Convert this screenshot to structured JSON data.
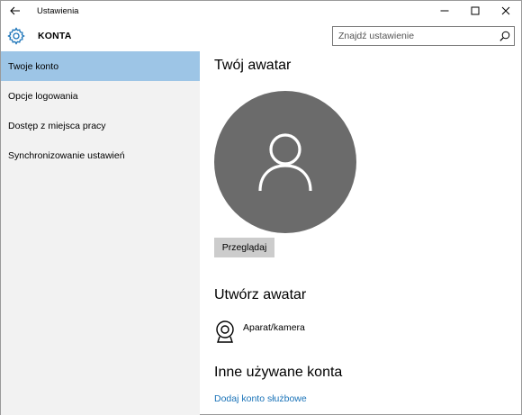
{
  "titlebar": {
    "title": "Ustawienia",
    "back_icon": "arrow-left-icon",
    "controls": [
      "minimize-icon",
      "maximize-icon",
      "close-icon"
    ]
  },
  "header": {
    "title": "KONTA",
    "icon": "gear-icon",
    "search_placeholder": "Znajdź ustawienie"
  },
  "sidebar": {
    "items": [
      {
        "label": "Twoje konto",
        "active": true
      },
      {
        "label": "Opcje logowania",
        "active": false
      },
      {
        "label": "Dostęp z miejsca pracy",
        "active": false
      },
      {
        "label": "Synchronizowanie ustawień",
        "active": false
      }
    ]
  },
  "main": {
    "avatar_heading": "Twój awatar",
    "browse_button": "Przeglądaj",
    "create_heading": "Utwórz awatar",
    "camera_label": "Aparat/kamera",
    "other_heading": "Inne używane konta",
    "add_account_link": "Dodaj konto służbowe"
  },
  "colors": {
    "accent_selected": "#9dc5e6",
    "sidebar_bg": "#f2f2f2",
    "avatar_bg": "#6b6b6b",
    "link": "#1a73b8",
    "button_bg": "#cccccc"
  }
}
